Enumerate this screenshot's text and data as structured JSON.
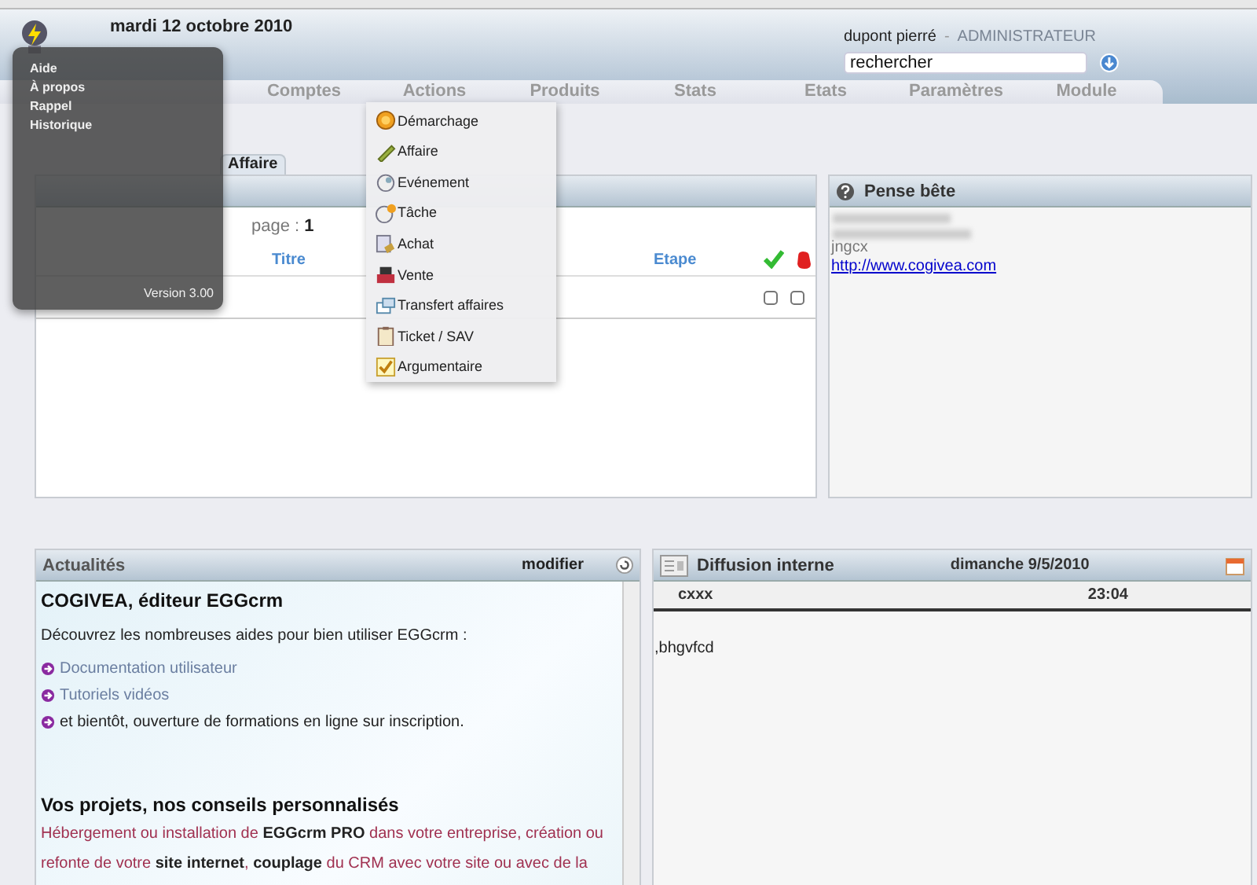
{
  "header": {
    "date": "mardi 12 octobre 2010",
    "user": "dupont pierré",
    "separator": "-",
    "role": "ADMINISTRATEUR",
    "search": {
      "value": "rechercher"
    }
  },
  "nav": [
    {
      "label": "Comptes"
    },
    {
      "label": "Actions"
    },
    {
      "label": "Produits"
    },
    {
      "label": "Stats"
    },
    {
      "label": "Etats"
    },
    {
      "label": "Paramètres"
    },
    {
      "label": "Module"
    }
  ],
  "tabs": [
    {
      "label": "Affaire",
      "selected": false
    }
  ],
  "reminders": {
    "page_label": "page :",
    "page": "1",
    "columns": [
      "Titre",
      "Etape"
    ],
    "rows": [
      {
        "done": false,
        "cancelled": false
      }
    ]
  },
  "notes": {
    "title": "Pense bête",
    "lines": [
      "jngcx"
    ],
    "link": "http://www.cogivea.com"
  },
  "news": {
    "title": "Actualités",
    "edit": "modifier",
    "heading": "COGIVEA, éditeur EGGcrm",
    "intro": "Découvrez les nombreuses aides pour bien utiliser EGGcrm :",
    "items": [
      {
        "kind": "link",
        "text": "Documentation utilisateur"
      },
      {
        "kind": "link",
        "text": "Tutoriels vidéos"
      },
      {
        "kind": "text",
        "text": "et bientôt, ouverture de formations en ligne sur inscription."
      }
    ],
    "heading2": "Vos projets, nos conseils personnalisés",
    "body": "Hébergement ou installation de **EGGcrm PRO** dans votre entreprise, création ou refonte de votre **site internet**, **couplage** du CRM avec votre site ou avec de la"
  },
  "diffusion": {
    "title": "Diffusion interne",
    "date": "dimanche  9/5/2010",
    "author": "cxxx",
    "time": "23:04",
    "message": ",bhgvfcd"
  },
  "help_menu": {
    "items": [
      "Aide",
      "À propos",
      "Rappel",
      "Historique"
    ],
    "version": "Version 3.00"
  },
  "actions_menu": {
    "items": [
      "Démarchage",
      "Affaire",
      "Evénement",
      "Tâche",
      "Achat",
      "Vente",
      "Transfert affaires",
      "Ticket / SAV",
      "Argumentaire"
    ]
  }
}
